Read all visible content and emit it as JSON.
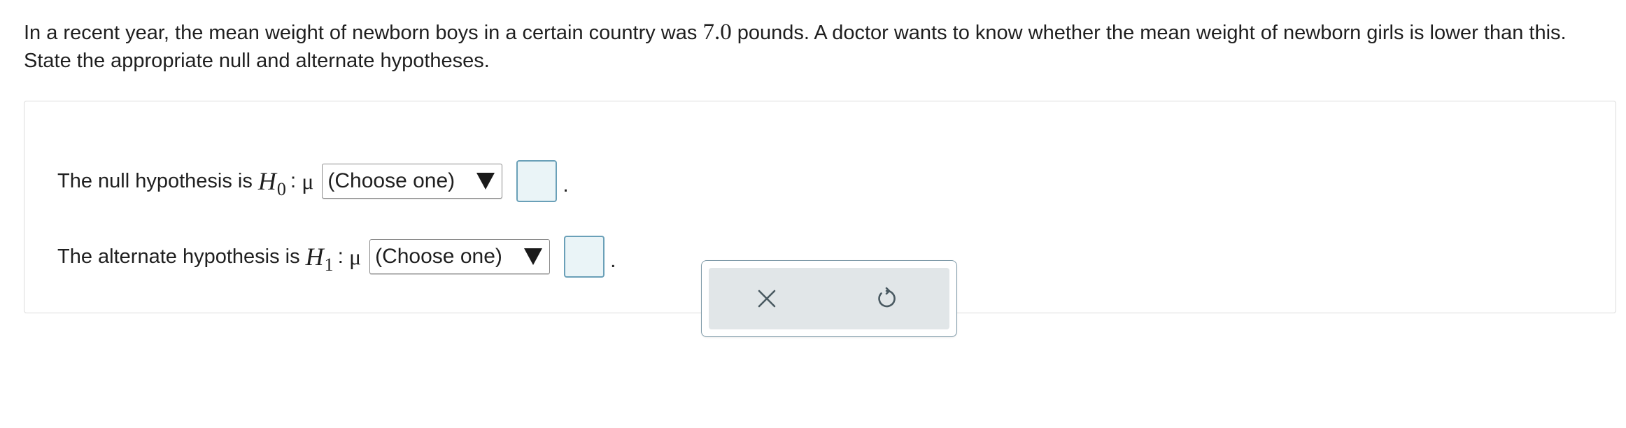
{
  "question": {
    "text_before": "In a recent year, the mean weight of newborn boys in a certain country was ",
    "value": "7.0",
    "text_after": " pounds. A doctor wants to know whether the mean weight of newborn girls is lower than this. State the appropriate null and alternate hypotheses."
  },
  "null_hypothesis": {
    "label": "The null hypothesis is",
    "variable": "H",
    "subscript": "0",
    "colon": ":",
    "parameter": "μ",
    "select_value": "(Choose one)",
    "input_value": "",
    "end": "."
  },
  "alternate_hypothesis": {
    "label": "The alternate hypothesis is",
    "variable": "H",
    "subscript": "1",
    "colon": ":",
    "parameter": "μ",
    "select_value": "(Choose one)",
    "input_value": "",
    "end": "."
  },
  "tools": {
    "clear_icon": "x-icon",
    "undo_icon": "undo-icon"
  },
  "colors": {
    "input_border": "#6aa0b8",
    "input_fill": "#eaf4f7",
    "tool_fill": "#e1e6e8",
    "tool_border": "#7f9aa8"
  }
}
